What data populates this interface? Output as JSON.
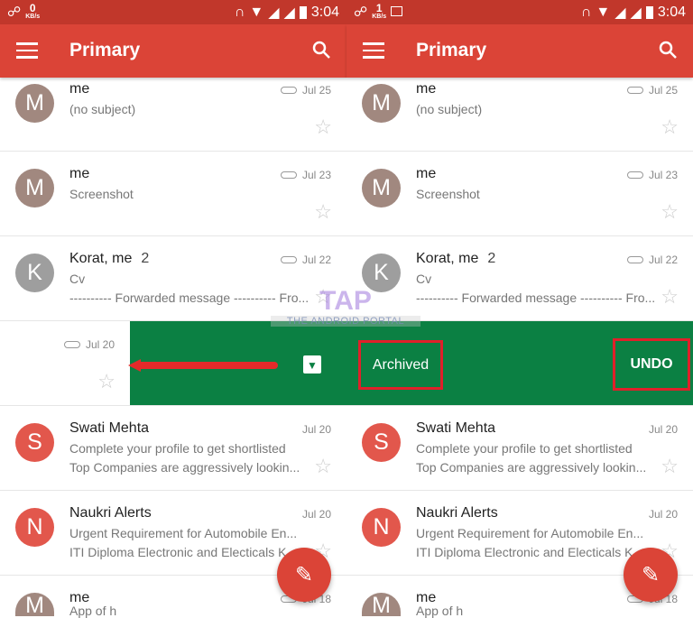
{
  "colors": {
    "appbar": "#db4437",
    "status": "#c1372b",
    "archive_green": "#0b8043",
    "highlight": "#e0202a"
  },
  "panels": [
    {
      "status": {
        "speed": "0",
        "unit": "KB/s",
        "time": "3:04",
        "extra_icon": ""
      },
      "appbar": {
        "title": "Primary"
      },
      "mode": "swiping"
    },
    {
      "status": {
        "speed": "1",
        "unit": "KB/s",
        "time": "3:04",
        "extra_icon": "image-icon"
      },
      "appbar": {
        "title": "Primary"
      },
      "mode": "archived",
      "archived_label": "Archived",
      "undo_label": "UNDO"
    }
  ],
  "emails": [
    {
      "initial": "M",
      "avatar_color": "#a1887f",
      "sender": "me",
      "count": "",
      "subject": "(no subject)",
      "snippet": "",
      "date": "Jul 25",
      "attachment": true
    },
    {
      "initial": "M",
      "avatar_color": "#a1887f",
      "sender": "me",
      "count": "",
      "subject": "Screenshot",
      "snippet": "",
      "date": "Jul 23",
      "attachment": true
    },
    {
      "initial": "K",
      "avatar_color": "#9e9e9e",
      "sender": "Korat, me",
      "count": "2",
      "subject": "Cv",
      "snippet": "---------- Forwarded message ---------- Fro...",
      "date": "Jul 22",
      "attachment": true
    },
    {
      "swipe": true,
      "date": "Jul 20",
      "attachment": true
    },
    {
      "initial": "S",
      "avatar_color": "#e2574c",
      "sender": "Swati Mehta",
      "count": "",
      "subject": "Complete your profile to get shortlisted",
      "snippet": "Top Companies are aggressively lookin...",
      "date": "Jul 20",
      "attachment": false
    },
    {
      "initial": "N",
      "avatar_color": "#e2574c",
      "sender": "Naukri Alerts",
      "count": "",
      "subject": "Urgent Requirement for Automobile En...",
      "snippet": "ITI Diploma Electronic and Electicals K...",
      "date": "Jul 20",
      "attachment": false
    },
    {
      "initial": "M",
      "avatar_color": "#a1887f",
      "sender": "me",
      "count": "",
      "subject": "App of h",
      "snippet": "",
      "date": "Jul 18",
      "attachment": true
    }
  ],
  "watermark": {
    "logo": "TAP",
    "text": "THE ANDROID PORTAL"
  }
}
